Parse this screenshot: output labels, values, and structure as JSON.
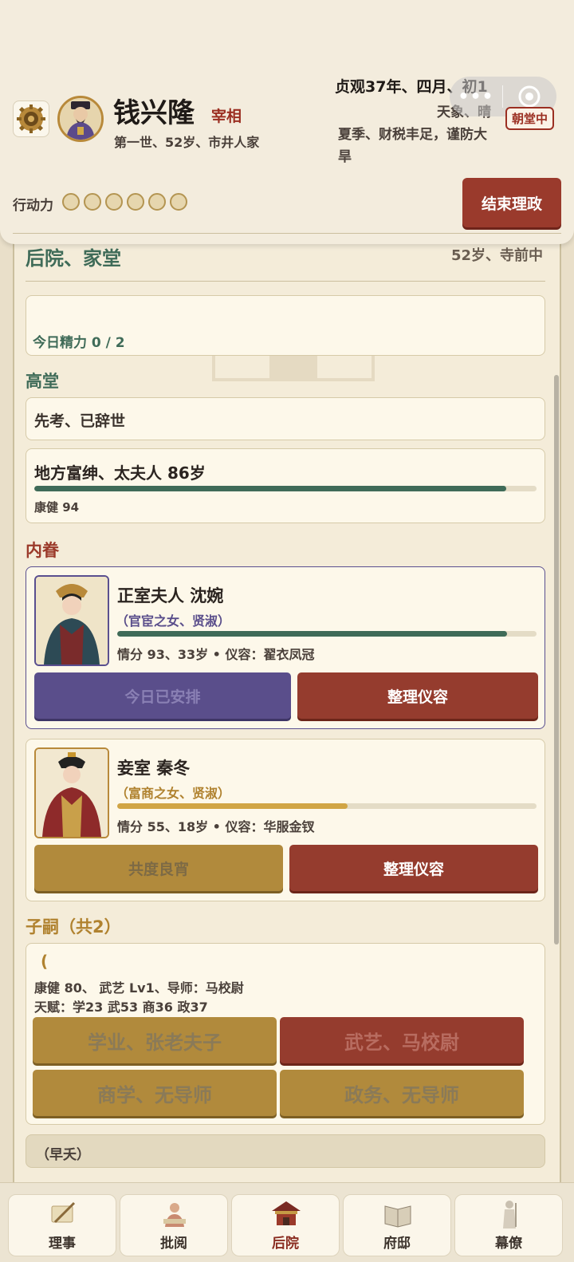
{
  "header": {
    "name": "钱兴隆",
    "rank": "宰相",
    "sub": "第一世、52岁、市井人家",
    "date": "贞观37年、四月、初1",
    "weather": "天象、晴",
    "season": "夏季、财税丰足，谨防大旱",
    "capsule_dots": "•••",
    "court_badge": "朝堂中",
    "action_label": "行动力",
    "action_points": 6,
    "end_button": "结束理政"
  },
  "panel": {
    "title_partial": "后院、家堂",
    "title_right_partial": "52岁、寺前中",
    "energy": "今日精力 0 / 2",
    "elders_title": "高堂",
    "father": "先考、已辞世",
    "mother_name": "地方富绅、太夫人  86岁",
    "mother_health_label": "康健 94",
    "mother_health": 94,
    "wives_title": "内眷",
    "wives": [
      {
        "title": "正室夫人 沈婉",
        "origin": "（官宦之女、贤淑）",
        "stats": "情分 93、33岁 • 仪容：翟衣凤冠",
        "affection": 93,
        "btn_left": "今日已安排",
        "btn_right": "整理仪容"
      },
      {
        "title": "妾室 秦冬",
        "origin": "（富商之女、贤淑）",
        "stats": "情分 55、18岁 • 仪容：华服金钗",
        "affection": 55,
        "btn_left": "共度良宵",
        "btn_right": "整理仪容"
      }
    ],
    "children_title": "子嗣（共2）",
    "child": {
      "name_partial": "(",
      "line1": "康健 80、 武艺 Lv1、导师：马校尉",
      "line2": "天赋：学23 武53 商36 政37",
      "btn1": "学业、张老夫子",
      "btn2": "武艺、马校尉",
      "btn3": "商学、无导师",
      "btn4": "政务、无导师"
    },
    "child2": "（早夭）"
  },
  "nav": {
    "items": [
      "理事",
      "批阅",
      "后院",
      "府邸",
      "幕僚"
    ],
    "active": 2
  },
  "colors": {
    "green_bar": "#3f6b58",
    "gold_bar": "#d1a545",
    "accent_red": "#9b3a2a"
  }
}
